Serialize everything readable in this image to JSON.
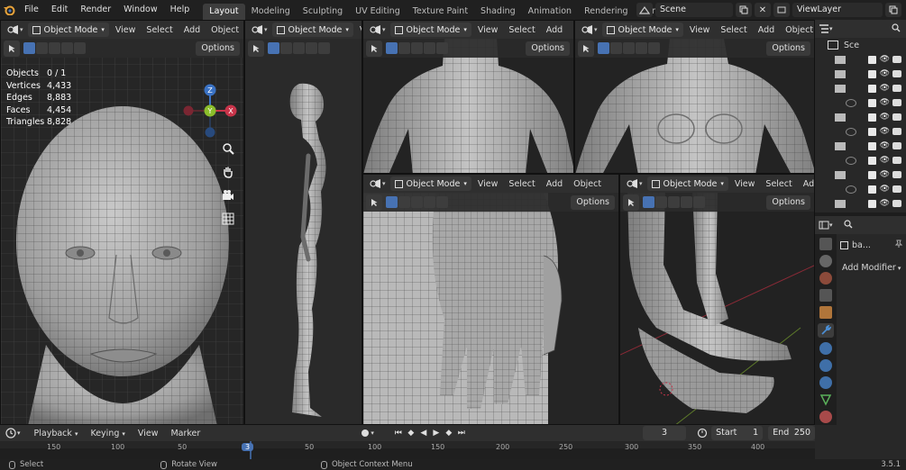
{
  "app": {
    "menus": [
      "File",
      "Edit",
      "Render",
      "Window",
      "Help"
    ],
    "workspaces": [
      "Layout",
      "Modeling",
      "Sculpting",
      "UV Editing",
      "Texture Paint",
      "Shading",
      "Animation",
      "Rendering",
      "Compositi"
    ],
    "active_workspace": "Layout",
    "scene_name": "Scene",
    "view_layer": "ViewLayer",
    "version": "3.5.1"
  },
  "viewport_header": {
    "mode": "Object Mode",
    "menus": [
      "View",
      "Select",
      "Add",
      "Object"
    ],
    "options": "Options"
  },
  "statistics": [
    {
      "label": "Objects",
      "value": "0 / 1"
    },
    {
      "label": "Vertices",
      "value": "4,433"
    },
    {
      "label": "Edges",
      "value": "8,883"
    },
    {
      "label": "Faces",
      "value": "4,454"
    },
    {
      "label": "Triangles",
      "value": "8,828"
    }
  ],
  "gizmo": {
    "x": "X",
    "y": "Y",
    "z": "Z",
    "x_color": "#c8344a",
    "y_color": "#8bbd2b",
    "z_color": "#3a72c4"
  },
  "outliner": {
    "root": "Sce"
  },
  "properties": {
    "object_name": "ba...",
    "add_modifier": "Add Modifier"
  },
  "timeline": {
    "menus": [
      "Playback",
      "Keying",
      "View",
      "Marker"
    ],
    "current_frame": "3",
    "start_label": "Start",
    "start": "1",
    "end_label": "End",
    "end": "250",
    "ruler_ticks": [
      "150",
      "100",
      "50",
      "3",
      "50",
      "100",
      "150",
      "200",
      "250",
      "300",
      "350",
      "400"
    ],
    "playhead": "3"
  },
  "statusbar": {
    "select": "Select",
    "rotate": "Rotate View",
    "context": "Object Context Menu"
  },
  "colors": {
    "accent": "#4772b3",
    "active_frame": "#4772b3"
  }
}
